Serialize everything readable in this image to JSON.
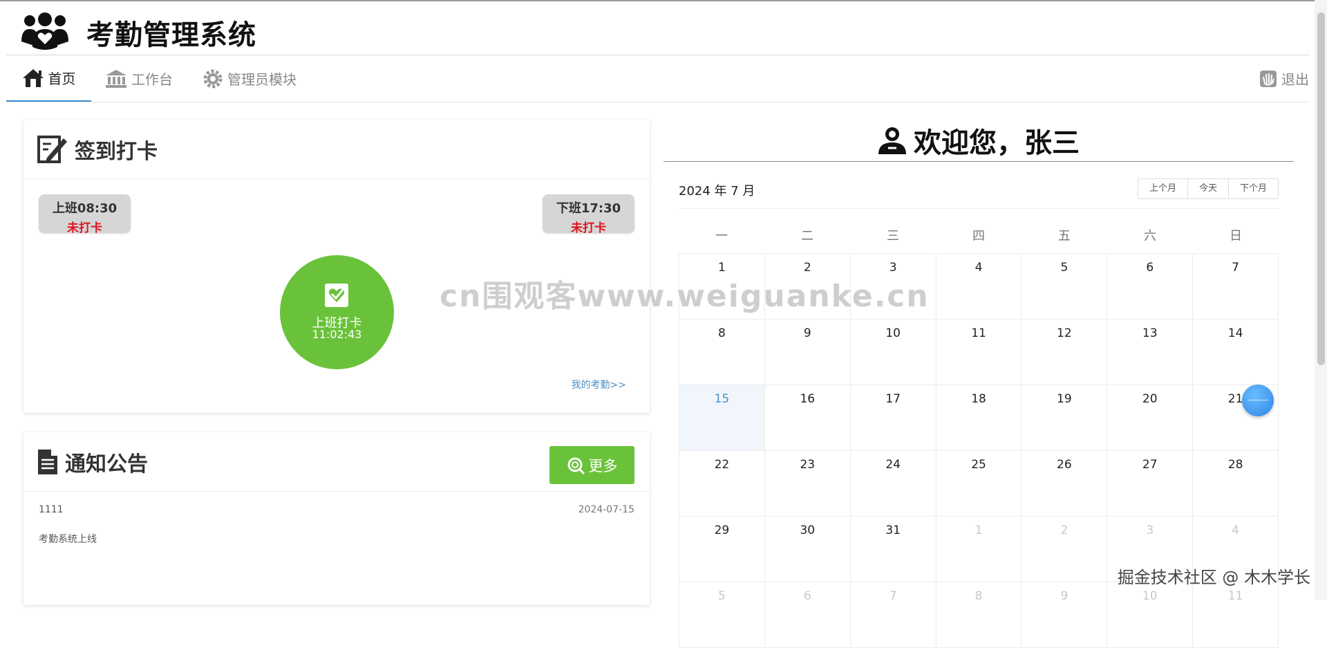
{
  "app": {
    "title": "考勤管理系统"
  },
  "nav": {
    "home": "首页",
    "workbench": "工作台",
    "admin": "管理员模块",
    "logout": "退出"
  },
  "checkin": {
    "title": "签到打卡",
    "on_duty": {
      "label": "上班08:30",
      "status": "未打卡"
    },
    "off_duty": {
      "label": "下班17:30",
      "status": "未打卡"
    },
    "punch_label": "上班打卡",
    "clock": "11:02:43",
    "my_attendance": "我的考勤>>"
  },
  "notice": {
    "title": "通知公告",
    "more": "更多",
    "items": [
      {
        "title": "1111",
        "date": "2024-07-15",
        "content": "考勤系统上线"
      }
    ]
  },
  "welcome": {
    "text": "欢迎您，张三"
  },
  "calendar": {
    "title": "2024 年 7 月",
    "prev": "上个月",
    "today": "今天",
    "next": "下个月",
    "weekdays": [
      "一",
      "二",
      "三",
      "四",
      "五",
      "六",
      "日"
    ],
    "weeks": [
      [
        "1",
        "2",
        "3",
        "4",
        "5",
        "6",
        "7"
      ],
      [
        "8",
        "9",
        "10",
        "11",
        "12",
        "13",
        "14"
      ],
      [
        "15",
        "16",
        "17",
        "18",
        "19",
        "20",
        "21"
      ],
      [
        "22",
        "23",
        "24",
        "25",
        "26",
        "27",
        "28"
      ],
      [
        "29",
        "30",
        "31",
        "1",
        "2",
        "3",
        "4"
      ],
      [
        "5",
        "6",
        "7",
        "8",
        "9",
        "10",
        "11"
      ]
    ],
    "today_date": "15"
  },
  "overlay": {
    "watermark": "cn围观客www.weiguanke.cn",
    "credit": "掘金技术社区 @ 木木学长"
  },
  "colors": {
    "accent_green": "#6ac23a",
    "link_blue": "#4a90c8",
    "alert_red": "#e0141e"
  }
}
